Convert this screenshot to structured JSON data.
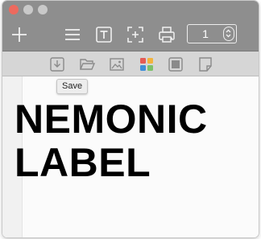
{
  "app": {
    "window_controls": [
      "close",
      "minimize",
      "zoom"
    ]
  },
  "toolbar": {
    "tools": [
      "add-icon",
      "list-icon",
      "text-box-icon",
      "crop-icon",
      "print-icon"
    ],
    "copies_value": "1"
  },
  "secondary_toolbar": {
    "tools": [
      "download-icon",
      "open-folder-icon",
      "image-icon",
      "color-palette-icon",
      "frame-icon",
      "blank-page-icon"
    ],
    "palette_colors": [
      "#e45b55",
      "#f2b33d",
      "#3f8fd8",
      "#7cc16a"
    ]
  },
  "tooltip": {
    "text": "Save"
  },
  "label": {
    "line1": "NEMONIC",
    "line2": "LABEL"
  },
  "colors": {
    "titlebar": "#8e8e8e",
    "toolbar2": "#d6d6d6",
    "close": "#ed6a5e"
  }
}
